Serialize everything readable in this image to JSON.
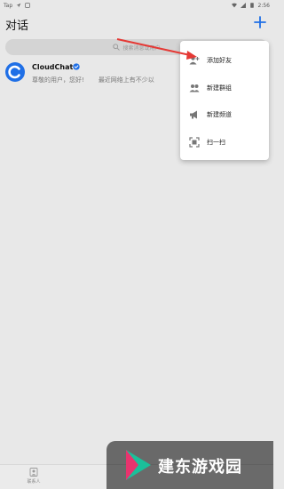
{
  "status_bar": {
    "left_text": "Tap",
    "time": "2:56"
  },
  "header": {
    "title": "对话",
    "add_icon": "plus-icon"
  },
  "search": {
    "placeholder": "搜索消息或用户"
  },
  "chats": [
    {
      "name": "CloudChat",
      "verified": true,
      "message": "尊敬的用户，您好!",
      "message_extra": "最近网络上有不少以",
      "avatar_color": "#1f6fe6"
    }
  ],
  "menu": {
    "items": [
      {
        "label": "添加好友",
        "icon": "add-user-icon"
      },
      {
        "label": "新建群组",
        "icon": "group-icon"
      },
      {
        "label": "新建频道",
        "icon": "megaphone-icon"
      },
      {
        "label": "扫一扫",
        "icon": "scan-icon"
      }
    ]
  },
  "bottom_nav": {
    "contacts_label": "联系人"
  },
  "watermark": {
    "text": "建东游戏园"
  },
  "colors": {
    "accent": "#1f6fe6",
    "annotation": "#e53935",
    "background": "#e8e8e8"
  }
}
